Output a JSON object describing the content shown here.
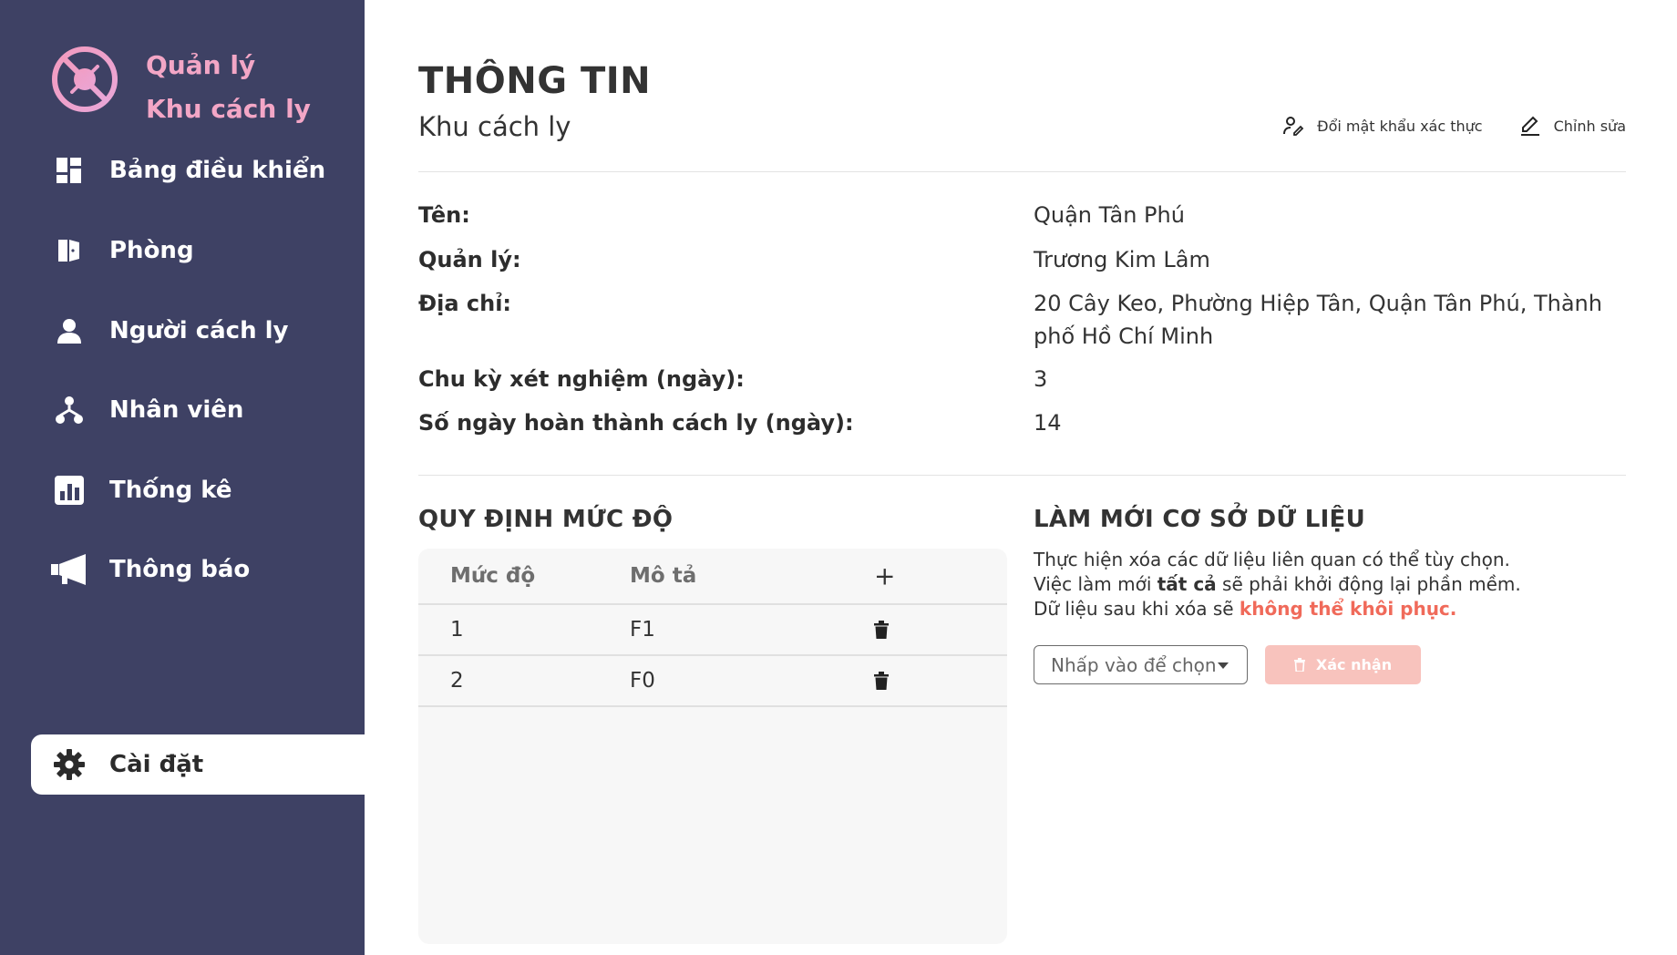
{
  "brand": {
    "line1": "Quản lý",
    "line2": "Khu cách ly",
    "logo_icon": "no-virus-icon"
  },
  "sidebar": {
    "items": [
      {
        "label": "Bảng điều khiển",
        "icon": "dashboard-icon"
      },
      {
        "label": "Phòng",
        "icon": "door-icon"
      },
      {
        "label": "Người cách ly",
        "icon": "person-icon"
      },
      {
        "label": "Nhân viên",
        "icon": "org-chart-icon"
      },
      {
        "label": "Thống kê",
        "icon": "bar-chart-icon"
      },
      {
        "label": "Thông báo",
        "icon": "megaphone-icon"
      },
      {
        "label": "Cài đặt",
        "icon": "gear-icon",
        "active": true
      }
    ]
  },
  "header": {
    "title": "THÔNG TIN",
    "subtitle": "Khu cách ly",
    "change_password_label": "Đổi mật khẩu xác thực",
    "edit_label": "Chỉnh sửa"
  },
  "info": [
    {
      "label": "Tên:",
      "value": "Quận Tân Phú"
    },
    {
      "label": "Quản lý:",
      "value": "Trương Kim Lâm"
    },
    {
      "label": "Địa chỉ:",
      "value": "20 Cây Keo, Phường Hiệp Tân, Quận Tân Phú, Thành phố Hồ Chí Minh"
    },
    {
      "label": "Chu kỳ xét nghiệm (ngày):",
      "value": "3"
    },
    {
      "label": "Số ngày hoàn thành cách ly (ngày):",
      "value": "14"
    }
  ],
  "levels": {
    "title": "QUY ĐỊNH MỨC ĐỘ",
    "columns": [
      "Mức độ",
      "Mô tả",
      "+"
    ],
    "rows": [
      {
        "level": "1",
        "description": "F1"
      },
      {
        "level": "2",
        "description": "F0"
      }
    ]
  },
  "refresh": {
    "title": "LÀM MỚI CƠ SỞ DỮ LIỆU",
    "line1": "Thực hiện xóa các dữ liệu liên quan có thể tùy chọn.",
    "line2_pre": "Việc làm mới ",
    "line2_bold": "tất cả",
    "line2_post": " sẽ phải khởi động lại phần mềm.",
    "line3_pre": "Dữ liệu sau khi xóa sẽ ",
    "line3_warn": "không thể khôi phục.",
    "select_placeholder": "Nhấp vào để chọn",
    "confirm_label": "Xác nhận"
  },
  "colors": {
    "sidebar_bg": "#3e4164",
    "brand_pink": "#f3a6c6",
    "warning": "#f06a5a",
    "confirm_disabled": "#f8c3bd"
  }
}
